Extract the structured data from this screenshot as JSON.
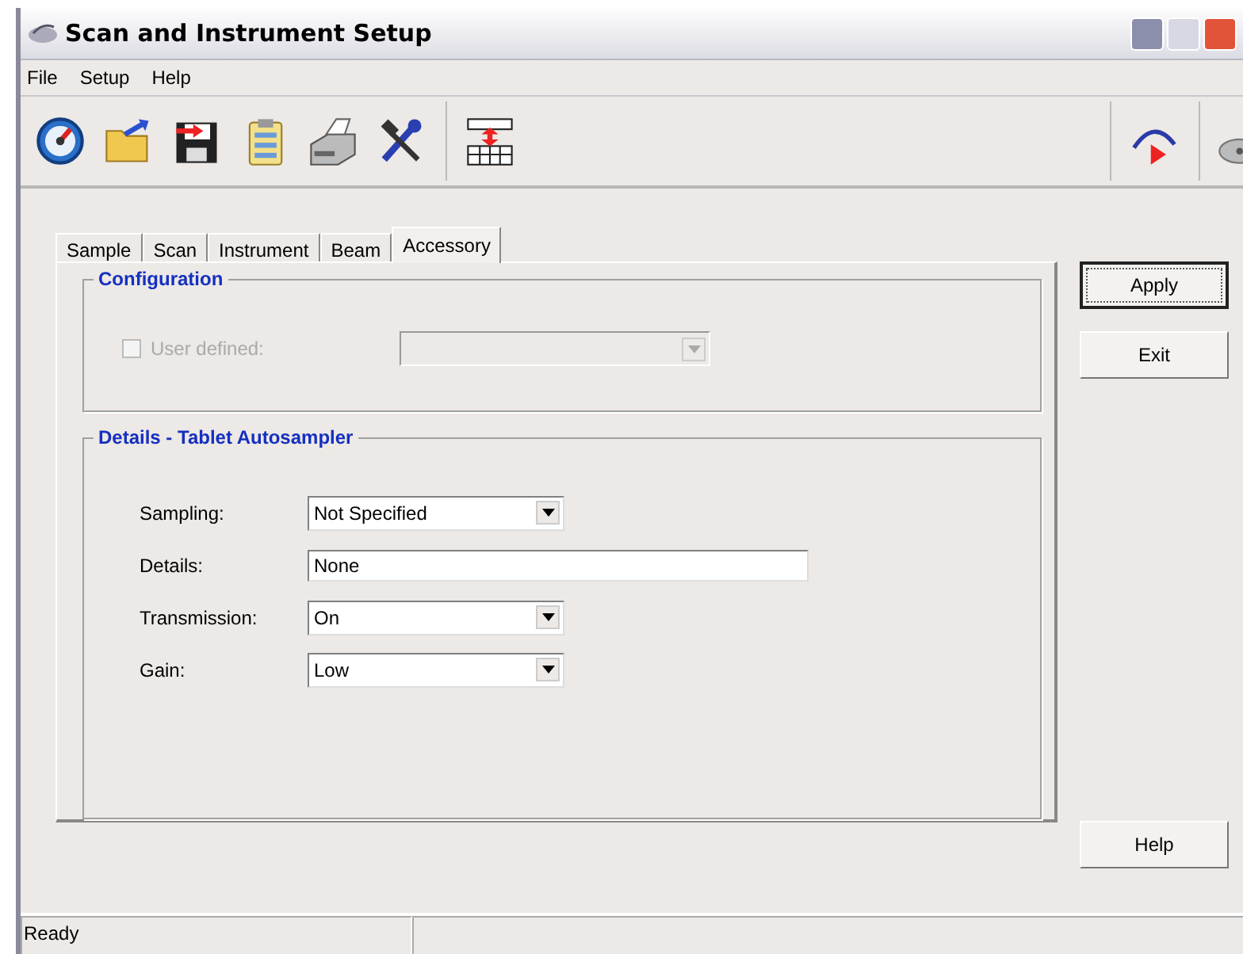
{
  "window": {
    "title": "Scan and Instrument Setup"
  },
  "menu": [
    "File",
    "Setup",
    "Help"
  ],
  "tabs": [
    {
      "label": "Sample",
      "selected": false
    },
    {
      "label": "Scan",
      "selected": false
    },
    {
      "label": "Instrument",
      "selected": false
    },
    {
      "label": "Beam",
      "selected": false
    },
    {
      "label": "Accessory",
      "selected": true
    }
  ],
  "configuration": {
    "title": "Configuration",
    "user_defined": {
      "label": "User defined:",
      "checked": false,
      "disabled": true
    },
    "dropdown": {
      "disabled": true
    }
  },
  "details": {
    "title": "Details - Tablet Autosampler",
    "fields": [
      {
        "label": "Sampling:",
        "kind": "dropdown",
        "value": "Not Specified"
      },
      {
        "label": "Details:",
        "kind": "text",
        "value": "None"
      },
      {
        "label": "Transmission:",
        "kind": "dropdown",
        "value": "On"
      },
      {
        "label": "Gain:",
        "kind": "dropdown",
        "value": "Low"
      }
    ]
  },
  "buttons": [
    {
      "label": "Apply",
      "default": true
    },
    {
      "label": "Exit",
      "default": false
    }
  ],
  "help_button": {
    "label": "Help"
  },
  "status_bar": {
    "message": "Ready"
  }
}
